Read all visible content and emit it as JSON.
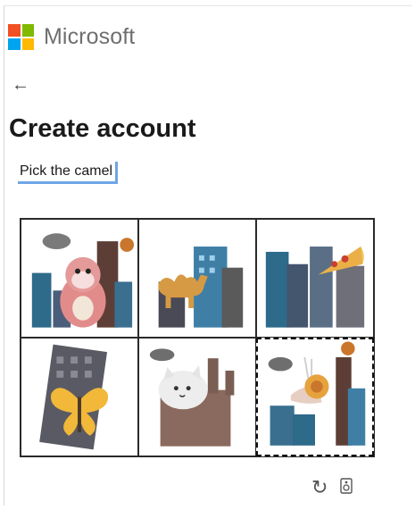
{
  "brand": {
    "name": "Microsoft",
    "logo_colors": [
      "#f25022",
      "#7fba00",
      "#00a4ef",
      "#ffb900"
    ]
  },
  "nav": {
    "back_icon": "←"
  },
  "page": {
    "title": "Create account"
  },
  "challenge": {
    "prompt": "Pick the camel",
    "tiles": [
      {
        "subject": "monkey",
        "selected": false
      },
      {
        "subject": "camel",
        "selected": false
      },
      {
        "subject": "pizza",
        "selected": false
      },
      {
        "subject": "butterfly",
        "selected": false
      },
      {
        "subject": "cat",
        "selected": false
      },
      {
        "subject": "snail",
        "selected": true
      }
    ]
  },
  "controls": {
    "refresh_icon": "↻",
    "audio_icon": "▯"
  }
}
